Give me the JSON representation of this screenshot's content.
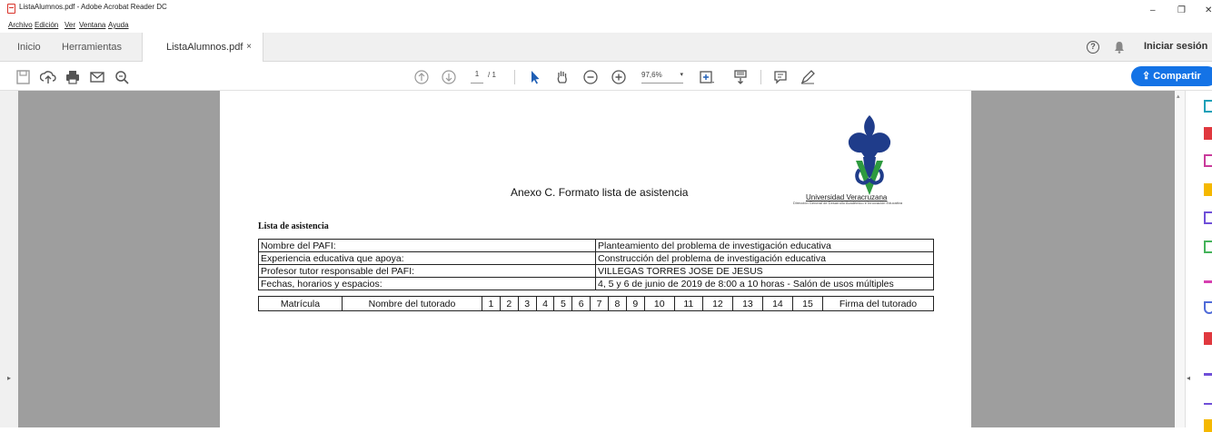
{
  "window": {
    "title": "ListaAlumnos.pdf - Adobe Acrobat Reader DC",
    "minimize": "–",
    "maximize": "❐",
    "close": "✕"
  },
  "menu": [
    "Archivo",
    "Edición",
    "Ver",
    "Ventana",
    "Ayuda"
  ],
  "tabs": {
    "home": "Inicio",
    "tools": "Herramientas",
    "document": "ListaAlumnos.pdf",
    "close": "×"
  },
  "header": {
    "help": "?",
    "signin": "Iniciar sesión"
  },
  "toolbar": {
    "page_current": "1",
    "page_total": "/ 1",
    "zoom": "97,6%",
    "zoom_arrow": "▾",
    "share": "Compartir"
  },
  "document": {
    "annex_title": "Anexo C. Formato lista de asistencia",
    "university": "Universidad Veracruzana",
    "university_sub": "Dirección General de Desarrollo Académico e Innovación Educativa",
    "list_heading": "Lista de asistencia",
    "info_rows": [
      {
        "label": "Nombre del PAFI:",
        "value": "Planteamiento del problema de investigación educativa"
      },
      {
        "label": "Experiencia educativa que apoya:",
        "value": "Construcción del problema de investigación educativa"
      },
      {
        "label": "Profesor tutor responsable del PAFI:",
        "value": "VILLEGAS TORRES JOSE DE JESUS"
      },
      {
        "label": "Fechas, horarios y espacios:",
        "value": "4, 5 y 6 de junio de 2019 de 8:00 a 10 horas - Salón de usos múltiples"
      }
    ],
    "attendance_headers": [
      "Matrícula",
      "Nombre del tutorado",
      "1",
      "2",
      "3",
      "4",
      "5",
      "6",
      "7",
      "8",
      "9",
      "10",
      "11",
      "12",
      "13",
      "14",
      "15",
      "Firma del tutorado"
    ]
  },
  "colors": {
    "accent": "#1473e6",
    "logo_blue": "#1f3c8a",
    "logo_green": "#2e9a3f",
    "gray_band": "#9e9e9e"
  }
}
